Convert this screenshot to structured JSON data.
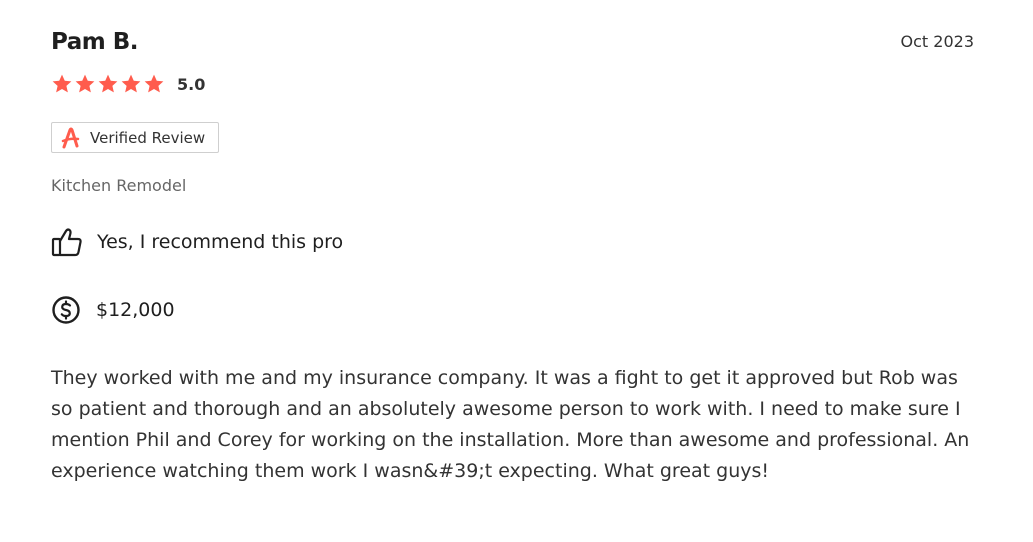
{
  "review": {
    "reviewer_name": "Pam B.",
    "date": "Oct 2023",
    "rating": 5,
    "rating_label": "5.0",
    "verified_label": "Verified Review",
    "service_type": "Kitchen Remodel",
    "recommend_label": "Yes, I recommend this pro",
    "cost": "$12,000",
    "body": "They worked with me and my insurance company. It was a fight to get it approved but Rob was so patient and thorough and an absolutely awesome person to work with. I need to make sure I mention Phil and Corey for working on the installation. More than awesome and professional. An experience watching them work I wasn&#39;t expecting. What great guys!"
  },
  "icons": {
    "star": "star-icon",
    "badge_logo": "angi-logo-icon",
    "recommend": "thumbs-up-icon",
    "cost": "dollar-circle-icon"
  },
  "colors": {
    "star": "#ff5c4d",
    "brand": "#ff5c4d",
    "text_primary": "#1f1f1f",
    "text_secondary": "#666666",
    "badge_border": "#cfcfcf"
  }
}
